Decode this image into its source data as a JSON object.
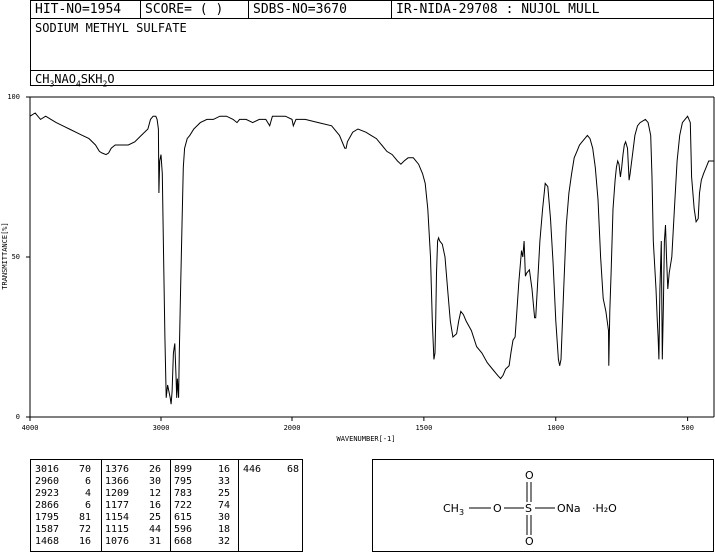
{
  "header": {
    "hit_no": "HIT-NO=1954",
    "score": "SCORE=  (   )",
    "sdbs_no": "SDBS-NO=3670",
    "ir_info": "IR-NIDA-29708 : NUJOL MULL"
  },
  "compound": {
    "name": "SODIUM METHYL SULFATE",
    "formula_parts": [
      "CH",
      "3",
      "NAO",
      "4",
      "SKH",
      "2",
      "O"
    ]
  },
  "chart_data": {
    "type": "line",
    "xlabel": "WAVENUMBER[-1]",
    "ylabel": "TRANSMITTANCE[%]",
    "xlim": [
      4000,
      400
    ],
    "ylim": [
      0,
      100
    ],
    "x_ticks": [
      4000,
      3000,
      2000,
      1500,
      1000,
      500
    ],
    "y_ticks": [
      0,
      50,
      100
    ],
    "grid": false,
    "series": [
      {
        "points": [
          [
            4000,
            94
          ],
          [
            3960,
            95
          ],
          [
            3920,
            93
          ],
          [
            3880,
            94
          ],
          [
            3840,
            93
          ],
          [
            3800,
            92
          ],
          [
            3750,
            91
          ],
          [
            3700,
            90
          ],
          [
            3650,
            89
          ],
          [
            3600,
            88
          ],
          [
            3550,
            87
          ],
          [
            3500,
            85
          ],
          [
            3470,
            83
          ],
          [
            3450,
            82.5
          ],
          [
            3420,
            82
          ],
          [
            3400,
            82.5
          ],
          [
            3380,
            84
          ],
          [
            3350,
            85
          ],
          [
            3300,
            85
          ],
          [
            3250,
            85
          ],
          [
            3200,
            86
          ],
          [
            3150,
            88
          ],
          [
            3100,
            90
          ],
          [
            3080,
            93
          ],
          [
            3060,
            94
          ],
          [
            3040,
            94
          ],
          [
            3030,
            93
          ],
          [
            3020,
            90
          ],
          [
            3016,
            70
          ],
          [
            3010,
            80
          ],
          [
            3000,
            82
          ],
          [
            2990,
            76
          ],
          [
            2980,
            50
          ],
          [
            2970,
            25
          ],
          [
            2960,
            6
          ],
          [
            2950,
            10
          ],
          [
            2940,
            8
          ],
          [
            2930,
            6
          ],
          [
            2923,
            4
          ],
          [
            2915,
            8
          ],
          [
            2905,
            20
          ],
          [
            2895,
            23
          ],
          [
            2885,
            12
          ],
          [
            2880,
            6
          ],
          [
            2875,
            12
          ],
          [
            2866,
            6
          ],
          [
            2860,
            20
          ],
          [
            2850,
            40
          ],
          [
            2840,
            60
          ],
          [
            2830,
            78
          ],
          [
            2820,
            84
          ],
          [
            2800,
            87
          ],
          [
            2780,
            88
          ],
          [
            2750,
            90
          ],
          [
            2700,
            92
          ],
          [
            2650,
            93
          ],
          [
            2600,
            93
          ],
          [
            2550,
            94
          ],
          [
            2500,
            94
          ],
          [
            2450,
            93
          ],
          [
            2420,
            92
          ],
          [
            2400,
            93
          ],
          [
            2350,
            93
          ],
          [
            2300,
            92
          ],
          [
            2250,
            93
          ],
          [
            2200,
            93
          ],
          [
            2170,
            91
          ],
          [
            2150,
            94
          ],
          [
            2100,
            94
          ],
          [
            2050,
            94
          ],
          [
            2000,
            93
          ],
          [
            1995,
            91
          ],
          [
            1985,
            93
          ],
          [
            1950,
            93
          ],
          [
            1900,
            92
          ],
          [
            1850,
            91
          ],
          [
            1820,
            88
          ],
          [
            1800,
            84
          ],
          [
            1795,
            84
          ],
          [
            1790,
            86
          ],
          [
            1770,
            89
          ],
          [
            1750,
            90
          ],
          [
            1720,
            89
          ],
          [
            1700,
            88
          ],
          [
            1680,
            87
          ],
          [
            1660,
            85
          ],
          [
            1640,
            83
          ],
          [
            1620,
            82
          ],
          [
            1600,
            80
          ],
          [
            1587,
            79
          ],
          [
            1575,
            80
          ],
          [
            1560,
            81
          ],
          [
            1540,
            81
          ],
          [
            1520,
            79
          ],
          [
            1505,
            76
          ],
          [
            1495,
            73
          ],
          [
            1485,
            65
          ],
          [
            1475,
            50
          ],
          [
            1468,
            30
          ],
          [
            1462,
            18
          ],
          [
            1458,
            20
          ],
          [
            1455,
            30
          ],
          [
            1452,
            45
          ],
          [
            1448,
            55
          ],
          [
            1444,
            56
          ],
          [
            1440,
            55
          ],
          [
            1430,
            54
          ],
          [
            1420,
            50
          ],
          [
            1410,
            40
          ],
          [
            1400,
            30
          ],
          [
            1390,
            25
          ],
          [
            1376,
            26
          ],
          [
            1368,
            30
          ],
          [
            1360,
            33
          ],
          [
            1350,
            32
          ],
          [
            1340,
            30
          ],
          [
            1320,
            27
          ],
          [
            1300,
            22
          ],
          [
            1280,
            20
          ],
          [
            1260,
            17
          ],
          [
            1240,
            15
          ],
          [
            1220,
            13
          ],
          [
            1209,
            12
          ],
          [
            1200,
            13
          ],
          [
            1190,
            15
          ],
          [
            1177,
            16
          ],
          [
            1170,
            20
          ],
          [
            1162,
            24
          ],
          [
            1154,
            25
          ],
          [
            1150,
            30
          ],
          [
            1140,
            42
          ],
          [
            1130,
            52
          ],
          [
            1125,
            50
          ],
          [
            1120,
            55
          ],
          [
            1115,
            44
          ],
          [
            1110,
            45
          ],
          [
            1100,
            46
          ],
          [
            1090,
            40
          ],
          [
            1080,
            31
          ],
          [
            1076,
            31
          ],
          [
            1070,
            40
          ],
          [
            1060,
            55
          ],
          [
            1050,
            65
          ],
          [
            1040,
            73
          ],
          [
            1030,
            72
          ],
          [
            1020,
            62
          ],
          [
            1010,
            48
          ],
          [
            1000,
            30
          ],
          [
            990,
            18
          ],
          [
            985,
            16
          ],
          [
            980,
            18
          ],
          [
            970,
            40
          ],
          [
            960,
            60
          ],
          [
            950,
            70
          ],
          [
            940,
            76
          ],
          [
            930,
            81
          ],
          [
            920,
            83
          ],
          [
            910,
            85
          ],
          [
            900,
            86
          ],
          [
            890,
            87
          ],
          [
            880,
            88
          ],
          [
            870,
            87
          ],
          [
            860,
            84
          ],
          [
            850,
            78
          ],
          [
            840,
            68
          ],
          [
            830,
            50
          ],
          [
            820,
            37
          ],
          [
            810,
            33
          ],
          [
            800,
            27
          ],
          [
            799,
            16
          ],
          [
            795,
            33
          ],
          [
            790,
            45
          ],
          [
            783,
            65
          ],
          [
            775,
            74
          ],
          [
            770,
            78
          ],
          [
            765,
            80
          ],
          [
            760,
            79
          ],
          [
            755,
            75
          ],
          [
            750,
            78
          ],
          [
            745,
            82
          ],
          [
            740,
            85
          ],
          [
            735,
            86
          ],
          [
            728,
            84
          ],
          [
            722,
            74
          ],
          [
            718,
            76
          ],
          [
            700,
            88
          ],
          [
            690,
            91
          ],
          [
            680,
            92
          ],
          [
            660,
            93
          ],
          [
            650,
            92
          ],
          [
            640,
            88
          ],
          [
            635,
            75
          ],
          [
            630,
            55
          ],
          [
            620,
            40
          ],
          [
            615,
            30
          ],
          [
            612,
            25
          ],
          [
            609,
            18
          ],
          [
            605,
            40
          ],
          [
            600,
            55
          ],
          [
            596,
            18
          ],
          [
            592,
            35
          ],
          [
            588,
            55
          ],
          [
            584,
            60
          ],
          [
            580,
            50
          ],
          [
            575,
            40
          ],
          [
            570,
            45
          ],
          [
            560,
            50
          ],
          [
            550,
            65
          ],
          [
            540,
            80
          ],
          [
            530,
            88
          ],
          [
            520,
            92
          ],
          [
            510,
            93
          ],
          [
            500,
            94
          ],
          [
            490,
            92
          ],
          [
            485,
            75
          ],
          [
            475,
            65
          ],
          [
            468,
            61
          ],
          [
            460,
            62
          ],
          [
            455,
            70
          ],
          [
            448,
            74
          ],
          [
            440,
            76
          ],
          [
            430,
            78
          ],
          [
            420,
            80
          ],
          [
            410,
            80
          ],
          [
            400,
            80
          ]
        ]
      }
    ]
  },
  "peak_table": [
    [
      [
        "3016",
        "70"
      ],
      [
        "2960",
        "6"
      ],
      [
        "2923",
        "4"
      ],
      [
        "2866",
        "6"
      ],
      [
        "1795",
        "81"
      ],
      [
        "1587",
        "72"
      ],
      [
        "1468",
        "16"
      ]
    ],
    [
      [
        "1376",
        "26"
      ],
      [
        "1366",
        "30"
      ],
      [
        "1209",
        "12"
      ],
      [
        "1177",
        "16"
      ],
      [
        "1154",
        "25"
      ],
      [
        "1115",
        "44"
      ],
      [
        "1076",
        "31"
      ]
    ],
    [
      [
        "899",
        "16"
      ],
      [
        "795",
        "33"
      ],
      [
        "783",
        "25"
      ],
      [
        "722",
        "74"
      ],
      [
        "615",
        "30"
      ],
      [
        "596",
        "18"
      ],
      [
        "668",
        "32"
      ]
    ],
    [
      [
        "446",
        "68"
      ]
    ]
  ],
  "structure": {
    "ch3": "CH",
    "ch3_sub": "3",
    "o1": "O",
    "s": "S",
    "o_top": "O",
    "o_bottom": "O",
    "ona": "ONa",
    "water": "·H₂O"
  }
}
